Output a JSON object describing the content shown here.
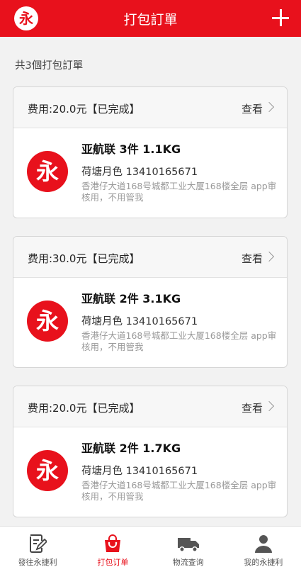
{
  "header": {
    "logo_char": "永",
    "title": "打包訂單"
  },
  "order_count": "共3個打包訂單",
  "orders": [
    {
      "fee": "费用:20.0元【已完成】",
      "view": "查看",
      "badge_char": "永",
      "name": "亚航联 3件 1.1KG",
      "contact": "荷塘月色 13410165671",
      "address": "香港仔大道168号城都工业大厦168楼全层 app审核用，不用管我"
    },
    {
      "fee": "费用:30.0元【已完成】",
      "view": "查看",
      "badge_char": "永",
      "name": "亚航联 2件 3.1KG",
      "contact": "荷塘月色 13410165671",
      "address": "香港仔大道168号城都工业大厦168楼全层 app审核用，不用管我"
    },
    {
      "fee": "费用:20.0元【已完成】",
      "view": "查看",
      "badge_char": "永",
      "name": "亚航联 2件 1.7KG",
      "contact": "荷塘月色 13410165671",
      "address": "香港仔大道168号城都工业大厦168楼全层 app审核用，不用管我"
    }
  ],
  "tabs": [
    {
      "label": "發往永捷利",
      "icon": "edit-document-icon"
    },
    {
      "label": "打包订单",
      "icon": "shopping-bag-icon",
      "active": true
    },
    {
      "label": "物流查询",
      "icon": "truck-icon"
    },
    {
      "label": "我的永捷利",
      "icon": "user-icon"
    }
  ],
  "colors": {
    "brand_red": "#e8111c",
    "background": "#f2f2f2",
    "muted_text": "#999999"
  }
}
